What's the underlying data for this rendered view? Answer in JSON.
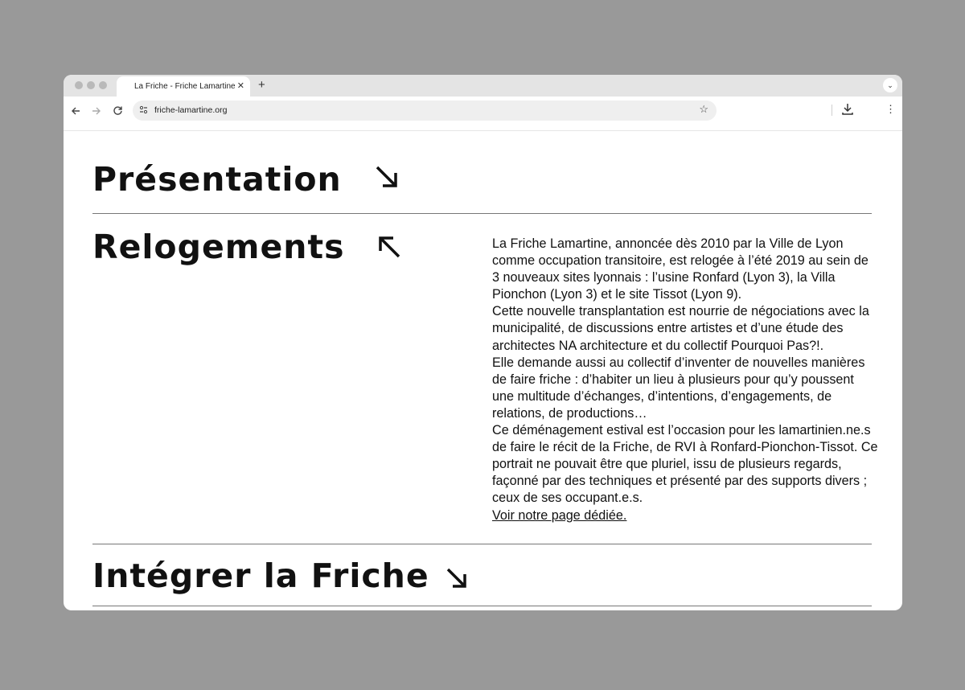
{
  "browser": {
    "tab_title": "La Friche - Friche Lamartine",
    "tab_close": "✕",
    "new_tab": "+",
    "tab_menu": "⌄",
    "url": "friche-lamartine.org",
    "icons": [
      "back-icon",
      "forward-icon",
      "reload-icon",
      "site-settings-icon",
      "bookmark-star-icon",
      "download-icon",
      "menu-kebab-icon"
    ]
  },
  "sections": {
    "presentation": {
      "title": "Présentation",
      "arrow": "down-right"
    },
    "relogements": {
      "title": "Relogements",
      "arrow": "up-left",
      "paragraphs": [
        "La Friche Lamartine, annoncée dès 2010 par la Ville de Lyon comme occupation transitoire, est relogée à l’été 2019 au sein de 3 nouveaux sites lyonnais : l’usine Ronfard (Lyon 3), la Villa Pionchon (Lyon 3) et le site Tissot (Lyon 9).",
        "Cette nouvelle transplantation est nourrie de négociations avec la municipalité, de discussions entre artistes et d’une étude des architectes NA architecture et du collectif Pourquoi Pas?!.",
        "Elle demande aussi au collectif d’inventer de nouvelles manières de faire friche : d’habiter un lieu à plusieurs pour qu’y poussent une multitude d’échanges, d’intentions, d’engagements, de relations, de productions…",
        "Ce déménagement estival est l’occasion pour les lamartinien.ne.s de faire le récit de la Friche, de RVI à Ronfard-Pionchon-Tissot. Ce portrait ne pouvait être que pluriel, issu de plusieurs regards, façonné par des techniques et présenté par des supports divers ; ceux de ses occupant.e.s."
      ],
      "link": "Voir notre page dédiée."
    },
    "integrer": {
      "title": "Intégrer la Friche",
      "arrow": "down-right"
    }
  }
}
